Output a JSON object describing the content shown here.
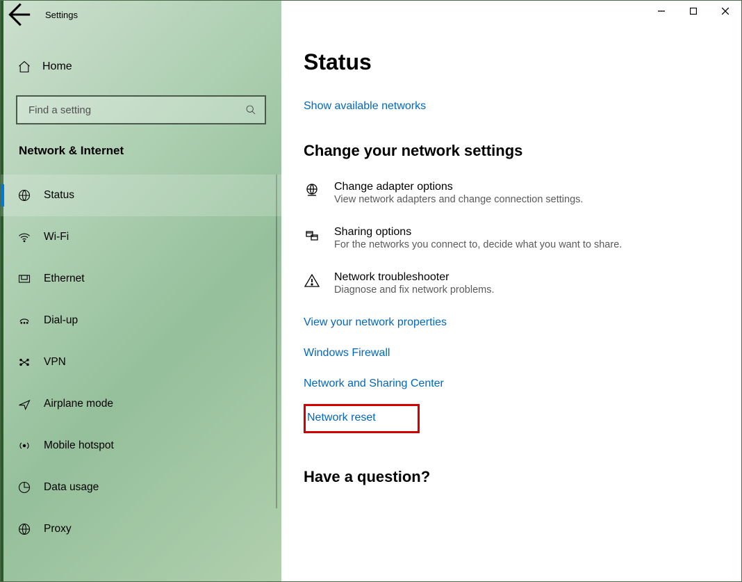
{
  "window": {
    "title": "Settings"
  },
  "sidebar": {
    "home": "Home",
    "search_placeholder": "Find a setting",
    "category": "Network & Internet",
    "items": [
      {
        "label": "Status"
      },
      {
        "label": "Wi-Fi"
      },
      {
        "label": "Ethernet"
      },
      {
        "label": "Dial-up"
      },
      {
        "label": "VPN"
      },
      {
        "label": "Airplane mode"
      },
      {
        "label": "Mobile hotspot"
      },
      {
        "label": "Data usage"
      },
      {
        "label": "Proxy"
      }
    ]
  },
  "main": {
    "title": "Status",
    "show_networks": "Show available networks",
    "change_heading": "Change your network settings",
    "options": [
      {
        "title": "Change adapter options",
        "desc": "View network adapters and change connection settings."
      },
      {
        "title": "Sharing options",
        "desc": "For the networks you connect to, decide what you want to share."
      },
      {
        "title": "Network troubleshooter",
        "desc": "Diagnose and fix network problems."
      }
    ],
    "links": [
      "View your network properties",
      "Windows Firewall",
      "Network and Sharing Center",
      "Network reset"
    ],
    "question": "Have a question?"
  }
}
